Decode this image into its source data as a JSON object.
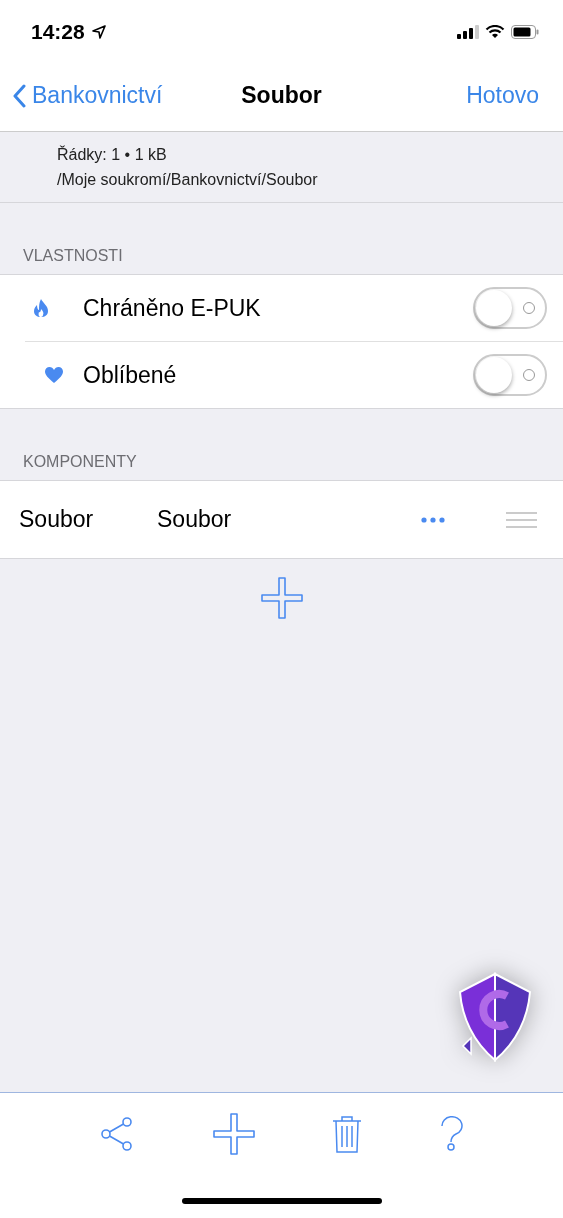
{
  "status_bar": {
    "time": "14:28"
  },
  "nav": {
    "back": "Bankovnictví",
    "title": "Soubor",
    "done": "Hotovo"
  },
  "info": {
    "lines": "Řádky: 1 • 1 kB",
    "path": "/Moje soukromí/Bankovnictví/Soubor"
  },
  "properties": {
    "header": "VLASTNOSTI",
    "items": [
      {
        "kind": "flame",
        "label": "Chráněno E-PUK",
        "on": false
      },
      {
        "kind": "heart",
        "label": "Oblíbené",
        "on": false
      }
    ]
  },
  "components": {
    "header": "KOMPONENTY",
    "rows": [
      {
        "name": "Soubor",
        "value": "Soubor"
      }
    ]
  }
}
